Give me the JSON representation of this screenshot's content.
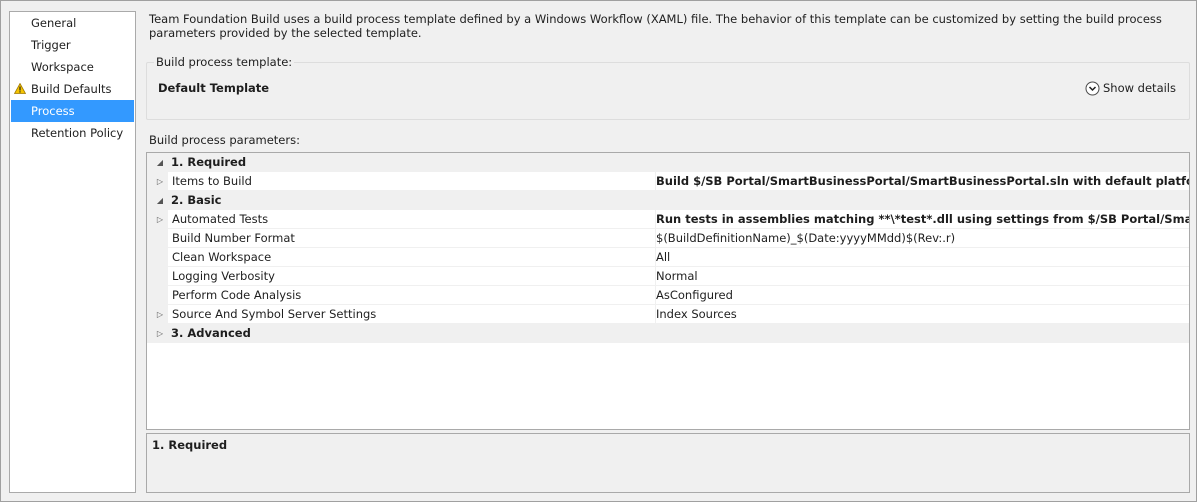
{
  "sidebar": {
    "items": [
      {
        "label": "General",
        "selected": false,
        "warning": false
      },
      {
        "label": "Trigger",
        "selected": false,
        "warning": false
      },
      {
        "label": "Workspace",
        "selected": false,
        "warning": false
      },
      {
        "label": "Build Defaults",
        "selected": false,
        "warning": true
      },
      {
        "label": "Process",
        "selected": true,
        "warning": false
      },
      {
        "label": "Retention Policy",
        "selected": false,
        "warning": false
      }
    ]
  },
  "main": {
    "description": "Team Foundation Build uses a build process template defined by a Windows Workflow (XAML) file. The behavior of this template can be customized by setting the build process parameters provided by the selected template.",
    "template_group_caption": "Build process template:",
    "template_name": "Default Template",
    "show_details_label": "Show details",
    "params_label": "Build process parameters:"
  },
  "grid": {
    "rows": [
      {
        "type": "category",
        "expander": "expanded",
        "name": "1. Required"
      },
      {
        "type": "property",
        "expander": "collapsed",
        "name": "Items to Build",
        "value": "Build $/SB Portal/SmartBusinessPortal/SmartBusinessPortal.sln with default platform and configuration",
        "bold": true
      },
      {
        "type": "category",
        "expander": "expanded",
        "name": "2. Basic"
      },
      {
        "type": "property",
        "expander": "collapsed",
        "name": "Automated Tests",
        "value": "Run tests in assemblies matching **\\*test*.dll using settings from $/SB Portal/SmartBusinessPortal/",
        "bold": true
      },
      {
        "type": "property",
        "expander": "none",
        "name": "Build Number Format",
        "value": "$(BuildDefinitionName)_$(Date:yyyyMMdd)$(Rev:.r)",
        "bold": false
      },
      {
        "type": "property",
        "expander": "none",
        "name": "Clean Workspace",
        "value": "All",
        "bold": false
      },
      {
        "type": "property",
        "expander": "none",
        "name": "Logging Verbosity",
        "value": "Normal",
        "bold": false
      },
      {
        "type": "property",
        "expander": "none",
        "name": "Perform Code Analysis",
        "value": "AsConfigured",
        "bold": false
      },
      {
        "type": "property",
        "expander": "collapsed",
        "name": "Source And Symbol Server Settings",
        "value": "Index Sources",
        "bold": false
      },
      {
        "type": "category",
        "expander": "collapsed",
        "name": "3. Advanced"
      }
    ]
  },
  "description_panel": {
    "title": "1. Required"
  },
  "icons": {
    "warning": "warning-icon",
    "show_details": "chevron-down-circle-icon",
    "expanded": "triangle-expanded-icon",
    "collapsed": "triangle-collapsed-icon"
  },
  "colors": {
    "selection": "#3399ff",
    "warning": "#f5c400"
  }
}
